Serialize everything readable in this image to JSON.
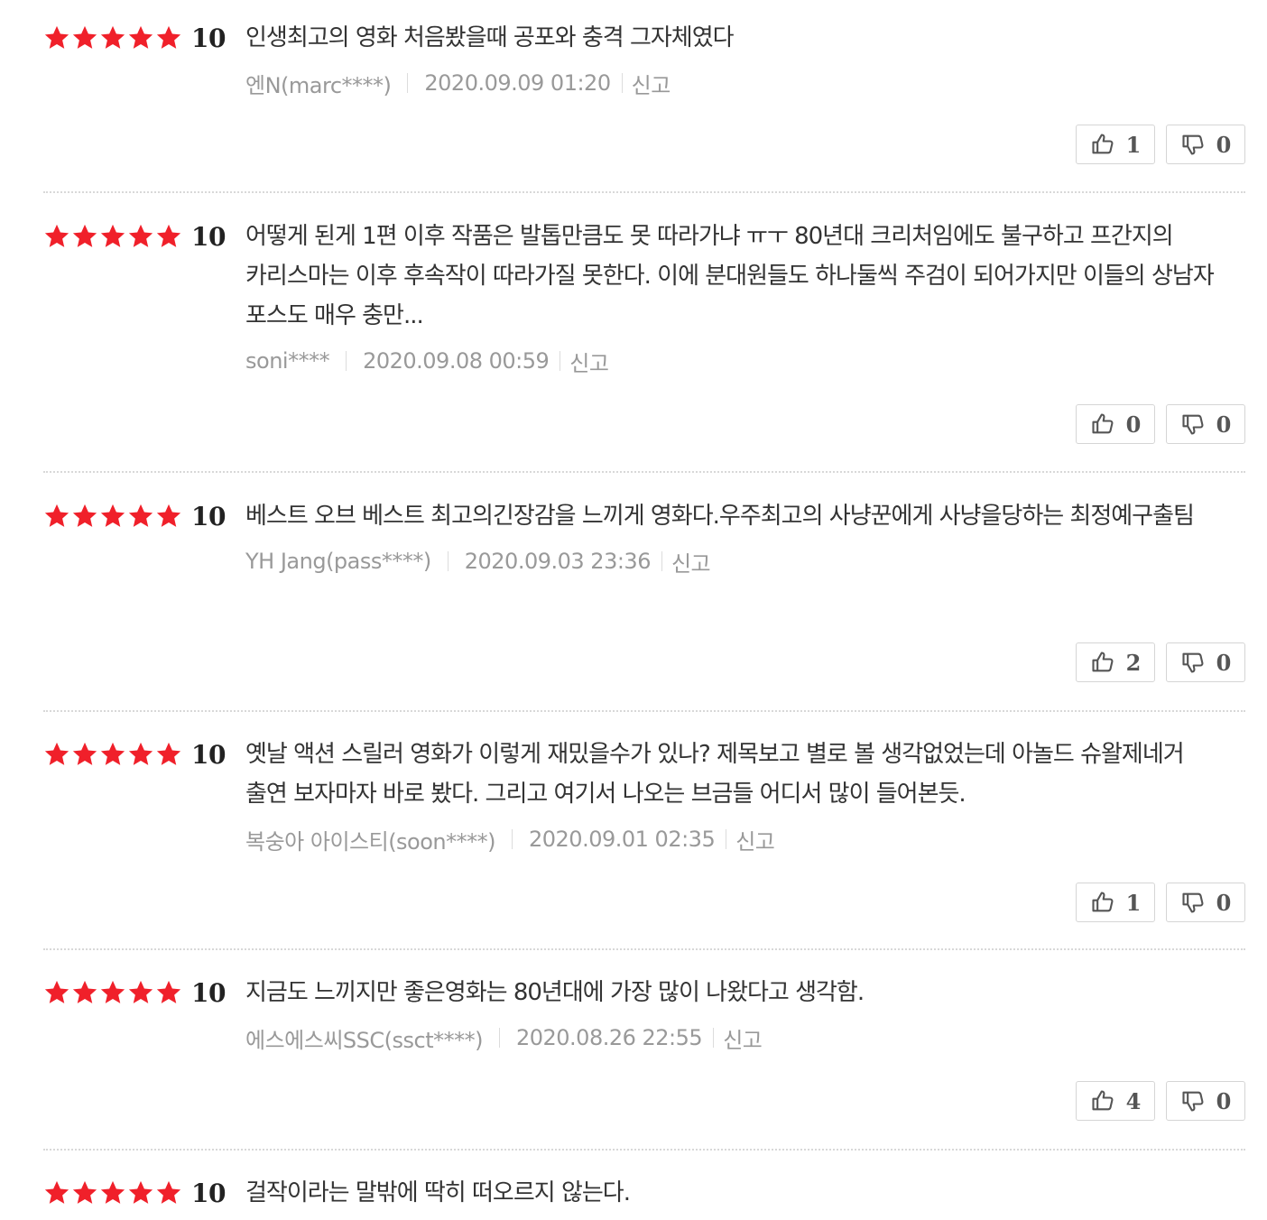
{
  "reviews": [
    {
      "rating": "10",
      "text": "인생최고의 영화 처음봤을때 공포와 충격 그자체였다",
      "author": "엔N(marc****)",
      "date": "2020.09.09 01:20",
      "report_label": "신고",
      "likes": "1",
      "dislikes": "0"
    },
    {
      "rating": "10",
      "text": "어떻게 된게 1편 이후 작품은 발톱만큼도 못 따라가냐 ㅠㅜ 80년대 크리처임에도 불구하고 프간지의 카리스마는 이후 후속작이 따라가질 못한다. 이에 분대원들도 하나둘씩 주검이 되어가지만 이들의 상남자 포스도 매우 충만...",
      "author": "soni****",
      "date": "2020.09.08 00:59",
      "report_label": "신고",
      "likes": "0",
      "dislikes": "0"
    },
    {
      "rating": "10",
      "text": "베스트 오브 베스트 최고의긴장감을 느끼게 영화다.우주최고의 사냥꾼에게 사냥을당하는 최정예구출팀",
      "author": "YH Jang(pass****)",
      "date": "2020.09.03 23:36",
      "report_label": "신고",
      "likes": "2",
      "dislikes": "0"
    },
    {
      "rating": "10",
      "text": "옛날 액션 스릴러 영화가 이렇게 재밌을수가 있나? 제목보고 별로 볼 생각없었는데 아놀드 슈왈제네거 출연 보자마자 바로 봤다. 그리고 여기서 나오는 브금들 어디서 많이 들어본듯.",
      "author": "복숭아 아이스티(soon****)",
      "date": "2020.09.01 02:35",
      "report_label": "신고",
      "likes": "1",
      "dislikes": "0"
    },
    {
      "rating": "10",
      "text": "지금도 느끼지만 좋은영화는 80년대에 가장 많이 나왔다고 생각함.",
      "author": "에스에스씨SSC(ssct****)",
      "date": "2020.08.26 22:55",
      "report_label": "신고",
      "likes": "4",
      "dislikes": "0"
    },
    {
      "rating": "10",
      "text": "걸작이라는 말밖에 딱히 떠오르지 않는다.",
      "author": "",
      "date": "",
      "report_label": "",
      "likes": "",
      "dislikes": ""
    }
  ],
  "colors": {
    "star": "#f0202a",
    "text": "#333333",
    "meta": "#999999",
    "border": "#d5d5d5"
  },
  "icons": {
    "like": "thumbs-up-icon",
    "dislike": "thumbs-down-icon",
    "star": "star-icon"
  }
}
